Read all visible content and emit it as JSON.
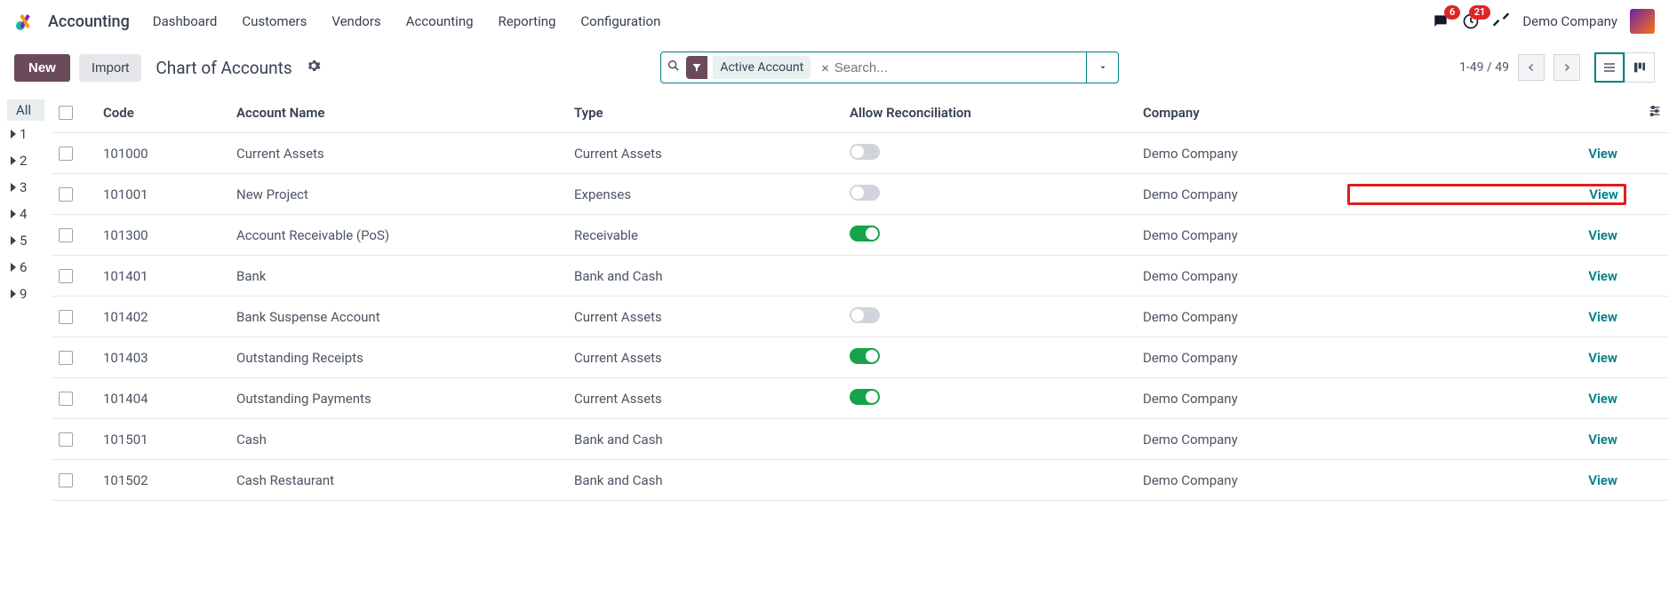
{
  "app": {
    "name": "Accounting"
  },
  "nav": {
    "items": [
      "Dashboard",
      "Customers",
      "Vendors",
      "Accounting",
      "Reporting",
      "Configuration"
    ]
  },
  "topnav_right": {
    "msg_badge": "6",
    "activity_badge": "21",
    "company": "Demo Company"
  },
  "controls": {
    "new_label": "New",
    "import_label": "Import",
    "title": "Chart of Accounts"
  },
  "search": {
    "chip_label": "Active Account",
    "placeholder": "Search..."
  },
  "pager": {
    "text": "1-49 / 49"
  },
  "sidebar": {
    "all_label": "All",
    "items": [
      "1",
      "2",
      "3",
      "4",
      "5",
      "6",
      "9"
    ]
  },
  "table": {
    "headers": {
      "code": "Code",
      "name": "Account Name",
      "type": "Type",
      "recon": "Allow Reconciliation",
      "company": "Company"
    },
    "view_label": "View",
    "rows": [
      {
        "code": "101000",
        "name": "Current Assets",
        "type": "Current Assets",
        "recon": "off",
        "company": "Demo Company",
        "highlight": false
      },
      {
        "code": "101001",
        "name": "New Project",
        "type": "Expenses",
        "recon": "off",
        "company": "Demo Company",
        "highlight": true
      },
      {
        "code": "101300",
        "name": "Account Receivable (PoS)",
        "type": "Receivable",
        "recon": "on",
        "company": "Demo Company",
        "highlight": false
      },
      {
        "code": "101401",
        "name": "Bank",
        "type": "Bank and Cash",
        "recon": "empty",
        "company": "Demo Company",
        "highlight": false
      },
      {
        "code": "101402",
        "name": "Bank Suspense Account",
        "type": "Current Assets",
        "recon": "off",
        "company": "Demo Company",
        "highlight": false
      },
      {
        "code": "101403",
        "name": "Outstanding Receipts",
        "type": "Current Assets",
        "recon": "on",
        "company": "Demo Company",
        "highlight": false
      },
      {
        "code": "101404",
        "name": "Outstanding Payments",
        "type": "Current Assets",
        "recon": "on",
        "company": "Demo Company",
        "highlight": false
      },
      {
        "code": "101501",
        "name": "Cash",
        "type": "Bank and Cash",
        "recon": "empty",
        "company": "Demo Company",
        "highlight": false
      },
      {
        "code": "101502",
        "name": "Cash Restaurant",
        "type": "Bank and Cash",
        "recon": "empty",
        "company": "Demo Company",
        "highlight": false
      }
    ]
  }
}
